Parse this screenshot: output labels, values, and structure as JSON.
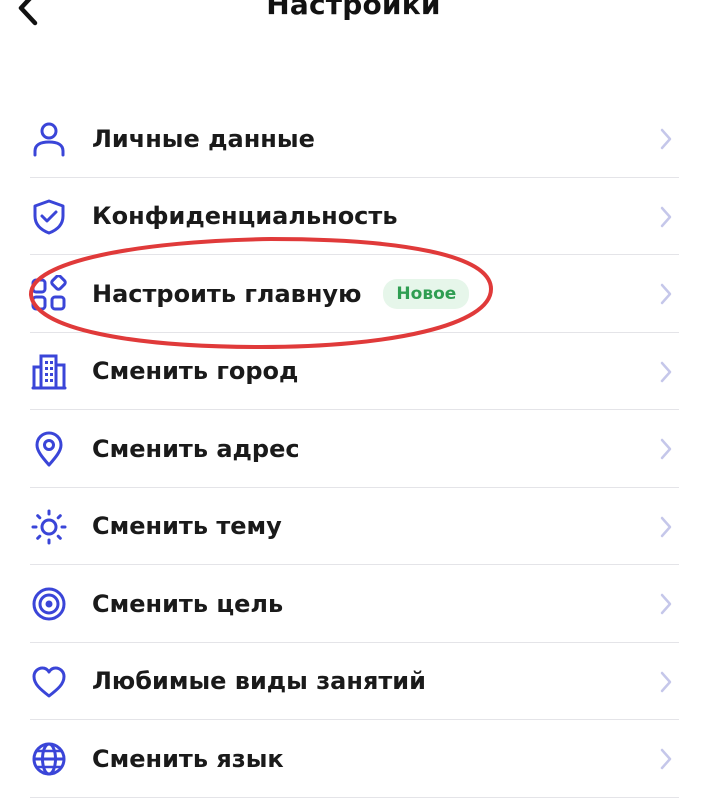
{
  "header": {
    "title": "Настройки",
    "back_icon": "chevron-left-icon"
  },
  "settings": {
    "items": [
      {
        "label": "Личные данные",
        "icon": "person-icon"
      },
      {
        "label": "Конфиденциальность",
        "icon": "shield-check-icon"
      },
      {
        "label": "Настроить главную",
        "icon": "widgets-grid-icon",
        "badge": "Новое"
      },
      {
        "label": "Сменить город",
        "icon": "building-icon"
      },
      {
        "label": "Сменить адрес",
        "icon": "location-pin-icon"
      },
      {
        "label": "Сменить тему",
        "icon": "sun-icon"
      },
      {
        "label": "Сменить цель",
        "icon": "target-icon"
      },
      {
        "label": "Любимые виды занятий",
        "icon": "heart-icon"
      },
      {
        "label": "Сменить язык",
        "icon": "globe-icon"
      }
    ]
  },
  "colors": {
    "icon_blue": "#3a45d8",
    "chevron": "#c5c7ea",
    "badge_bg": "#e6f6ea",
    "badge_text": "#2f9e52",
    "highlight_red": "#e03a3a"
  }
}
